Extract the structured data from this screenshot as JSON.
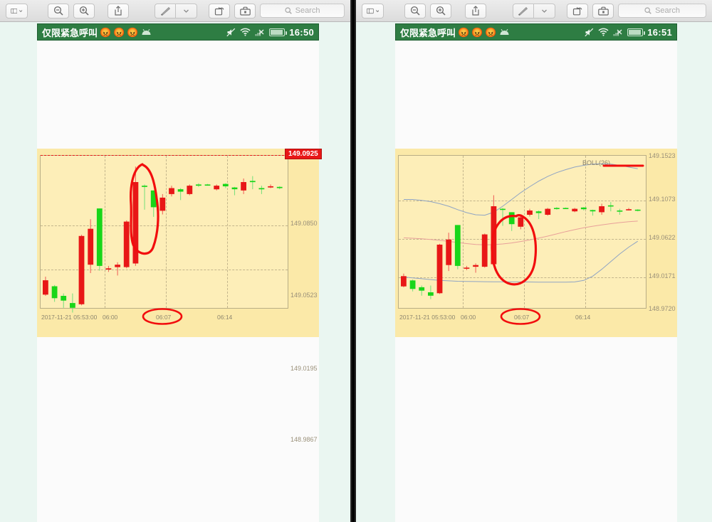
{
  "window": {
    "toolbar": {
      "sidebar_label": "sidebar-view",
      "zoom_out_label": "Zoom Out",
      "zoom_in_label": "Zoom In",
      "share_label": "Share",
      "markup_label": "Markup",
      "markup_menu_label": "Markup Options",
      "rotate_label": "Rotate",
      "toolbox_label": "Toolbox"
    },
    "search": {
      "placeholder": "Search",
      "value": ""
    }
  },
  "panels": [
    {
      "id": "left",
      "statusbar": {
        "carrier": "仅限紧急呼叫",
        "emoji": [
          "😡",
          "😡",
          "😡"
        ],
        "android_icon": "android-icon",
        "mute_icon": "mute-icon",
        "wifi_icon": "wifi-icon",
        "signal_icon": "signal-no-service-icon",
        "battery_icon": "battery-icon",
        "clock": "16:50"
      },
      "chart": {
        "price_tag": "149.0925",
        "indicator_label": "",
        "y_labels": [
          "149.0850",
          "149.0523",
          "149.0195",
          "148.9867"
        ],
        "x_labels": [
          "2017-11-21 05:53:00",
          "06:00",
          "06:07",
          "06:14"
        ],
        "annotations": [
          "ellipse-around-candle",
          "ellipse-around-0607-label"
        ]
      }
    },
    {
      "id": "right",
      "statusbar": {
        "carrier": "仅限紧急呼叫",
        "emoji": [
          "😡",
          "😡",
          "😡"
        ],
        "android_icon": "android-icon",
        "mute_icon": "mute-icon",
        "wifi_icon": "wifi-icon",
        "signal_icon": "signal-no-service-icon",
        "battery_icon": "battery-icon",
        "clock": "16:51"
      },
      "chart": {
        "price_tag": "",
        "indicator_label": "BOLL(26)",
        "y_labels": [
          "149.1523",
          "149.1073",
          "149.0622",
          "149.0171",
          "148.9720"
        ],
        "x_labels": [
          "2017-11-21 05:53:00",
          "06:00",
          "06:07",
          "06:14"
        ],
        "annotations": [
          "underline-boll-label",
          "ellipse-around-candle",
          "ellipse-around-0607-label"
        ]
      }
    }
  ],
  "colors": {
    "up": "#19d619",
    "down": "#e81717",
    "chart_bg": "#fdeeb8",
    "panel_bg": "#fbe9a8",
    "grid": "#c3b58c",
    "statusbar": "#2e7d43",
    "annotation": "#f20d0d",
    "boll_band": "#8fa4c4",
    "boll_mid": "#e8a09a",
    "desktop": "#eaf6f1"
  },
  "chart_data": {
    "type": "candlestick",
    "title": "",
    "xlabel": "",
    "ylabel": "",
    "charts": [
      {
        "name": "left-chart-plain",
        "ylim": [
          148.9867,
          149.115
        ],
        "y_ticks": [
          148.9867,
          149.0195,
          149.0523,
          149.085
        ],
        "x_ticks": [
          "2017-11-21 05:53:00",
          "06:00",
          "06:07",
          "06:14"
        ],
        "last_price": 149.0925,
        "grid": true,
        "indicators": [],
        "candles": [
          {
            "t": "05:53",
            "o": 149.011,
            "h": 149.014,
            "l": 148.998,
            "c": 148.999,
            "dir": "down"
          },
          {
            "t": "05:54",
            "o": 148.996,
            "h": 149.007,
            "l": 148.993,
            "c": 149.006,
            "dir": "up"
          },
          {
            "t": "05:55",
            "o": 148.994,
            "h": 149.0,
            "l": 148.988,
            "c": 148.998,
            "dir": "up"
          },
          {
            "t": "05:56",
            "o": 148.988,
            "h": 149.0,
            "l": 148.984,
            "c": 148.992,
            "dir": "up"
          },
          {
            "t": "05:57",
            "o": 149.048,
            "h": 149.049,
            "l": 148.99,
            "c": 148.991,
            "dir": "down"
          },
          {
            "t": "05:58",
            "o": 149.054,
            "h": 149.062,
            "l": 149.017,
            "c": 149.024,
            "dir": "down"
          },
          {
            "t": "05:59",
            "o": 149.023,
            "h": 149.025,
            "l": 149.019,
            "c": 149.071,
            "dir": "up"
          },
          {
            "t": "06:00",
            "o": 149.02,
            "h": 149.023,
            "l": 149.018,
            "c": 149.021,
            "dir": "down"
          },
          {
            "t": "06:01",
            "o": 149.022,
            "h": 149.026,
            "l": 149.015,
            "c": 149.024,
            "dir": "down"
          },
          {
            "t": "06:02",
            "o": 149.06,
            "h": 149.061,
            "l": 149.021,
            "c": 149.022,
            "dir": "down"
          },
          {
            "t": "06:03",
            "o": 149.093,
            "h": 149.106,
            "l": 149.023,
            "c": 149.025,
            "dir": "down"
          },
          {
            "t": "06:04",
            "o": 149.09,
            "h": 149.091,
            "l": 149.07,
            "c": 149.089,
            "dir": "up"
          },
          {
            "t": "06:05",
            "o": 149.072,
            "h": 149.074,
            "l": 149.064,
            "c": 149.086,
            "dir": "up"
          },
          {
            "t": "06:06",
            "o": 149.08,
            "h": 149.083,
            "l": 149.066,
            "c": 149.069,
            "dir": "down"
          },
          {
            "t": "06:07",
            "o": 149.088,
            "h": 149.09,
            "l": 149.081,
            "c": 149.083,
            "dir": "down"
          },
          {
            "t": "06:08",
            "o": 149.085,
            "h": 149.088,
            "l": 149.078,
            "c": 149.087,
            "dir": "up"
          },
          {
            "t": "06:09",
            "o": 149.09,
            "h": 149.091,
            "l": 149.082,
            "c": 149.083,
            "dir": "down"
          },
          {
            "t": "06:10",
            "o": 149.09,
            "h": 149.092,
            "l": 149.089,
            "c": 149.091,
            "dir": "up"
          },
          {
            "t": "06:11",
            "o": 149.0905,
            "h": 149.0915,
            "l": 149.09,
            "c": 149.091,
            "dir": "up"
          },
          {
            "t": "06:12",
            "o": 149.09,
            "h": 149.091,
            "l": 149.086,
            "c": 149.087,
            "dir": "down"
          },
          {
            "t": "06:13",
            "o": 149.0895,
            "h": 149.092,
            "l": 149.088,
            "c": 149.0915,
            "dir": "up"
          },
          {
            "t": "06:14",
            "o": 149.087,
            "h": 149.089,
            "l": 149.082,
            "c": 149.0885,
            "dir": "up"
          },
          {
            "t": "06:15",
            "o": 149.093,
            "h": 149.096,
            "l": 149.083,
            "c": 149.086,
            "dir": "down"
          },
          {
            "t": "06:16",
            "o": 149.094,
            "h": 149.098,
            "l": 149.087,
            "c": 149.093,
            "dir": "up"
          },
          {
            "t": "06:17",
            "o": 149.088,
            "h": 149.09,
            "l": 149.083,
            "c": 149.087,
            "dir": "up"
          },
          {
            "t": "06:18",
            "o": 149.0895,
            "h": 149.091,
            "l": 149.088,
            "c": 149.0885,
            "dir": "down"
          },
          {
            "t": "06:19",
            "o": 149.088,
            "h": 149.0895,
            "l": 149.087,
            "c": 149.089,
            "dir": "up"
          }
        ]
      },
      {
        "name": "right-chart-boll",
        "ylim": [
          148.972,
          149.1523
        ],
        "y_ticks": [
          148.972,
          149.0171,
          149.0622,
          149.1073,
          149.1523
        ],
        "x_ticks": [
          "2017-11-21 05:53:00",
          "06:00",
          "06:07",
          "06:14"
        ],
        "grid": true,
        "indicators": [
          {
            "name": "BOLL(26) upper",
            "color": "#8fa4c4"
          },
          {
            "name": "BOLL(26) middle",
            "color": "#e8a09a"
          },
          {
            "name": "BOLL(26) lower",
            "color": "#8fa4c4"
          }
        ],
        "candles": [
          {
            "t": "05:53",
            "o": 149.011,
            "h": 149.014,
            "l": 148.998,
            "c": 148.999,
            "dir": "down"
          },
          {
            "t": "05:54",
            "o": 148.996,
            "h": 149.007,
            "l": 148.993,
            "c": 149.006,
            "dir": "up"
          },
          {
            "t": "05:55",
            "o": 148.994,
            "h": 149.0,
            "l": 148.988,
            "c": 148.998,
            "dir": "up"
          },
          {
            "t": "05:56",
            "o": 148.988,
            "h": 149.0,
            "l": 148.984,
            "c": 148.992,
            "dir": "up"
          },
          {
            "t": "05:57",
            "o": 149.048,
            "h": 149.049,
            "l": 148.99,
            "c": 148.991,
            "dir": "down"
          },
          {
            "t": "05:58",
            "o": 149.054,
            "h": 149.062,
            "l": 149.017,
            "c": 149.024,
            "dir": "down"
          },
          {
            "t": "05:59",
            "o": 149.023,
            "h": 149.025,
            "l": 149.019,
            "c": 149.071,
            "dir": "up"
          },
          {
            "t": "06:00",
            "o": 149.02,
            "h": 149.023,
            "l": 149.018,
            "c": 149.021,
            "dir": "down"
          },
          {
            "t": "06:01",
            "o": 149.022,
            "h": 149.026,
            "l": 149.015,
            "c": 149.024,
            "dir": "down"
          },
          {
            "t": "06:02",
            "o": 149.06,
            "h": 149.061,
            "l": 149.021,
            "c": 149.022,
            "dir": "down"
          },
          {
            "t": "06:03",
            "o": 149.093,
            "h": 149.106,
            "l": 149.023,
            "c": 149.025,
            "dir": "down"
          },
          {
            "t": "06:04",
            "o": 149.09,
            "h": 149.091,
            "l": 149.07,
            "c": 149.089,
            "dir": "up"
          },
          {
            "t": "06:05",
            "o": 149.072,
            "h": 149.074,
            "l": 149.064,
            "c": 149.086,
            "dir": "up"
          },
          {
            "t": "06:06",
            "o": 149.08,
            "h": 149.083,
            "l": 149.066,
            "c": 149.069,
            "dir": "down"
          },
          {
            "t": "06:07",
            "o": 149.088,
            "h": 149.09,
            "l": 149.081,
            "c": 149.083,
            "dir": "down"
          },
          {
            "t": "06:08",
            "o": 149.085,
            "h": 149.088,
            "l": 149.078,
            "c": 149.087,
            "dir": "up"
          },
          {
            "t": "06:09",
            "o": 149.09,
            "h": 149.091,
            "l": 149.082,
            "c": 149.083,
            "dir": "down"
          },
          {
            "t": "06:10",
            "o": 149.09,
            "h": 149.092,
            "l": 149.089,
            "c": 149.091,
            "dir": "up"
          },
          {
            "t": "06:11",
            "o": 149.0905,
            "h": 149.0915,
            "l": 149.09,
            "c": 149.091,
            "dir": "up"
          },
          {
            "t": "06:12",
            "o": 149.09,
            "h": 149.091,
            "l": 149.086,
            "c": 149.087,
            "dir": "down"
          },
          {
            "t": "06:13",
            "o": 149.0895,
            "h": 149.092,
            "l": 149.088,
            "c": 149.0915,
            "dir": "up"
          },
          {
            "t": "06:14",
            "o": 149.087,
            "h": 149.089,
            "l": 149.082,
            "c": 149.0885,
            "dir": "up"
          },
          {
            "t": "06:15",
            "o": 149.093,
            "h": 149.096,
            "l": 149.083,
            "c": 149.086,
            "dir": "down"
          },
          {
            "t": "06:16",
            "o": 149.094,
            "h": 149.098,
            "l": 149.087,
            "c": 149.093,
            "dir": "up"
          },
          {
            "t": "06:17",
            "o": 149.088,
            "h": 149.09,
            "l": 149.083,
            "c": 149.087,
            "dir": "up"
          },
          {
            "t": "06:18",
            "o": 149.0895,
            "h": 149.091,
            "l": 149.088,
            "c": 149.0885,
            "dir": "down"
          },
          {
            "t": "06:19",
            "o": 149.088,
            "h": 149.0895,
            "l": 149.087,
            "c": 149.089,
            "dir": "up"
          }
        ],
        "boll_upper": [
          149.101,
          149.101,
          149.1,
          149.0985,
          149.096,
          149.093,
          149.089,
          149.0855,
          149.083,
          149.0825,
          149.086,
          149.093,
          149.101,
          149.109,
          149.116,
          149.1225,
          149.128,
          149.1325,
          149.136,
          149.139,
          149.141,
          149.1425,
          149.143,
          149.1425,
          149.141,
          149.139,
          149.137
        ],
        "boll_mid": [
          149.056,
          149.0555,
          149.0548,
          149.054,
          149.053,
          149.0518,
          149.0505,
          149.0492,
          149.0482,
          149.0478,
          149.048,
          149.0488,
          149.05,
          149.0516,
          149.0535,
          149.0556,
          149.058,
          149.0606,
          149.0632,
          149.0656,
          149.0678,
          149.0696,
          149.0712,
          149.0726,
          149.0738,
          149.0748,
          149.0756
        ],
        "boll_lower": [
          149.01,
          149.009,
          149.008,
          149.007,
          149.006,
          149.0055,
          149.005,
          149.0048,
          149.0046,
          149.0045,
          149.0044,
          149.0043,
          149.0042,
          149.0042,
          149.0041,
          149.004,
          149.004,
          149.004,
          149.004,
          149.0042,
          149.006,
          149.011,
          149.019,
          149.028,
          149.037,
          149.045,
          149.052
        ]
      }
    ]
  }
}
